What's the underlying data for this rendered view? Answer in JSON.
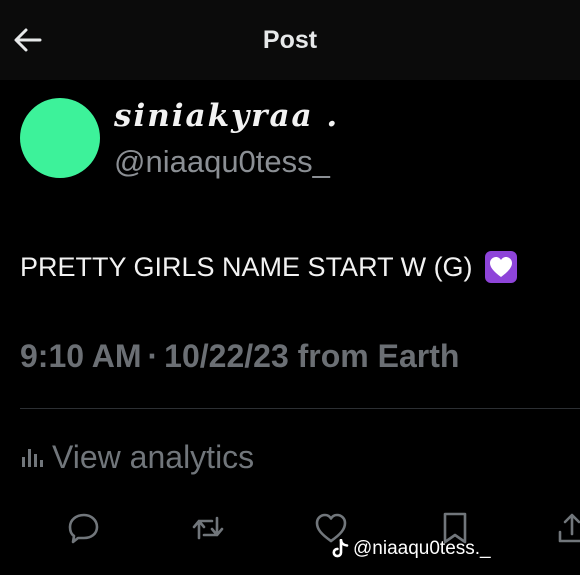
{
  "header": {
    "title": "Post",
    "back_icon": "back-arrow-icon"
  },
  "author": {
    "display_name": "siniakyraa .",
    "handle": "@niaaqu0tess_",
    "avatar_color": "#3df29a"
  },
  "post": {
    "text": "PRETTY GIRLS NAME START W (G)",
    "emoji": "purple-heart-emoji"
  },
  "meta": {
    "time": "9:10 AM",
    "separator": "·",
    "date": "10/22/23",
    "source": "from Earth"
  },
  "analytics": {
    "label": "View analytics",
    "icon": "analytics-bars-icon"
  },
  "actions": [
    "reply-icon",
    "repost-icon",
    "like-icon",
    "bookmark-icon",
    "share-icon"
  ],
  "watermark": {
    "text": "@niaaqu0tess._",
    "icon": "tiktok-icon"
  }
}
